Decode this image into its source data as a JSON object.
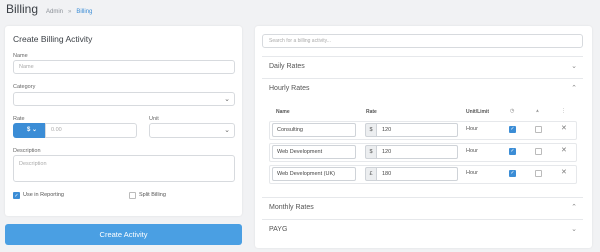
{
  "header": {
    "title": "Billing",
    "breadcrumb": [
      "Admin",
      "Billing"
    ]
  },
  "form": {
    "title": "Create Billing Activity",
    "name_label": "Name",
    "name_placeholder": "Name",
    "category_label": "Category",
    "rate_label": "Rate",
    "currency": "$",
    "rate_placeholder": "0.00",
    "unit_label": "Unit",
    "description_label": "Description",
    "description_placeholder": "Description",
    "use_in_reporting_label": "Use in Reporting",
    "use_in_reporting_checked": true,
    "split_billing_label": "Split Billing",
    "split_billing_checked": false,
    "submit_label": "Create Activity"
  },
  "rates": {
    "search_placeholder": "Search for a billing activity...",
    "sections": [
      {
        "title": "Daily Rates",
        "expanded": false
      },
      {
        "title": "Hourly Rates",
        "expanded": true
      },
      {
        "title": "Monthly Rates",
        "expanded": false
      },
      {
        "title": "PAYG",
        "expanded": false
      }
    ],
    "columns": {
      "name": "Name",
      "rate": "Rate",
      "unit": "Unit/Limit"
    },
    "rows": [
      {
        "name": "Consulting",
        "currency": "$",
        "rate": "120",
        "unit": "Hour",
        "flag1": true,
        "flag2": false
      },
      {
        "name": "Web Development",
        "currency": "$",
        "rate": "120",
        "unit": "Hour",
        "flag1": true,
        "flag2": false
      },
      {
        "name": "Web Development (UK)",
        "currency": "£",
        "rate": "180",
        "unit": "Hour",
        "flag1": true,
        "flag2": false
      }
    ]
  },
  "colors": {
    "accent": "#3b8dd6",
    "button": "#4a9fe3"
  }
}
